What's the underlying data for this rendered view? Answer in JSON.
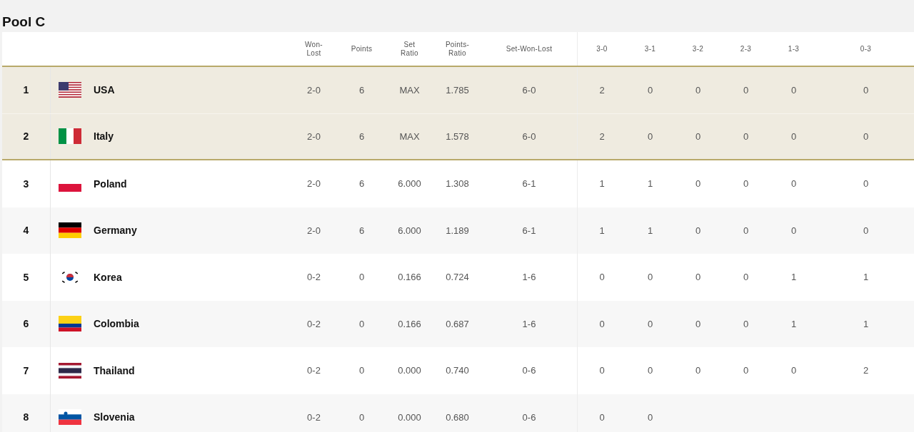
{
  "title": "Pool C",
  "columns": [
    "Won-\nLost",
    "Points",
    "Set\nRatio",
    "Points-\nRatio",
    "Set-Won-Lost",
    "3-0",
    "3-1",
    "3-2",
    "2-3",
    "1-3",
    "0-3"
  ],
  "rows": [
    {
      "rank": "1",
      "kind": "usa",
      "team": "USA",
      "qualified": true,
      "cells": [
        "2-0",
        "6",
        "MAX",
        "1.785",
        "6-0",
        "2",
        "0",
        "0",
        "0",
        "0",
        "0"
      ]
    },
    {
      "rank": "2",
      "kind": "italy",
      "team": "Italy",
      "qualified": true,
      "cells": [
        "2-0",
        "6",
        "MAX",
        "1.578",
        "6-0",
        "2",
        "0",
        "0",
        "0",
        "0",
        "0"
      ]
    },
    {
      "rank": "3",
      "kind": "poland",
      "team": "Poland",
      "qualified": false,
      "cells": [
        "2-0",
        "6",
        "6.000",
        "1.308",
        "6-1",
        "1",
        "1",
        "0",
        "0",
        "0",
        "0"
      ]
    },
    {
      "rank": "4",
      "kind": "germany",
      "team": "Germany",
      "qualified": false,
      "cells": [
        "2-0",
        "6",
        "6.000",
        "1.189",
        "6-1",
        "1",
        "1",
        "0",
        "0",
        "0",
        "0"
      ]
    },
    {
      "rank": "5",
      "kind": "korea",
      "team": "Korea",
      "qualified": false,
      "cells": [
        "0-2",
        "0",
        "0.166",
        "0.724",
        "1-6",
        "0",
        "0",
        "0",
        "0",
        "1",
        "1"
      ]
    },
    {
      "rank": "6",
      "kind": "colombia",
      "team": "Colombia",
      "qualified": false,
      "cells": [
        "0-2",
        "0",
        "0.166",
        "0.687",
        "1-6",
        "0",
        "0",
        "0",
        "0",
        "1",
        "1"
      ]
    },
    {
      "rank": "7",
      "kind": "thailand",
      "team": "Thailand",
      "qualified": false,
      "cells": [
        "0-2",
        "0",
        "0.000",
        "0.740",
        "0-6",
        "0",
        "0",
        "0",
        "0",
        "0",
        "2"
      ]
    },
    {
      "rank": "8",
      "kind": "slovenia",
      "team": "Slovenia",
      "qualified": false,
      "cells": [
        "0-2",
        "0",
        "0.000",
        "0.680",
        "0-6",
        "0",
        "0"
      ]
    }
  ]
}
